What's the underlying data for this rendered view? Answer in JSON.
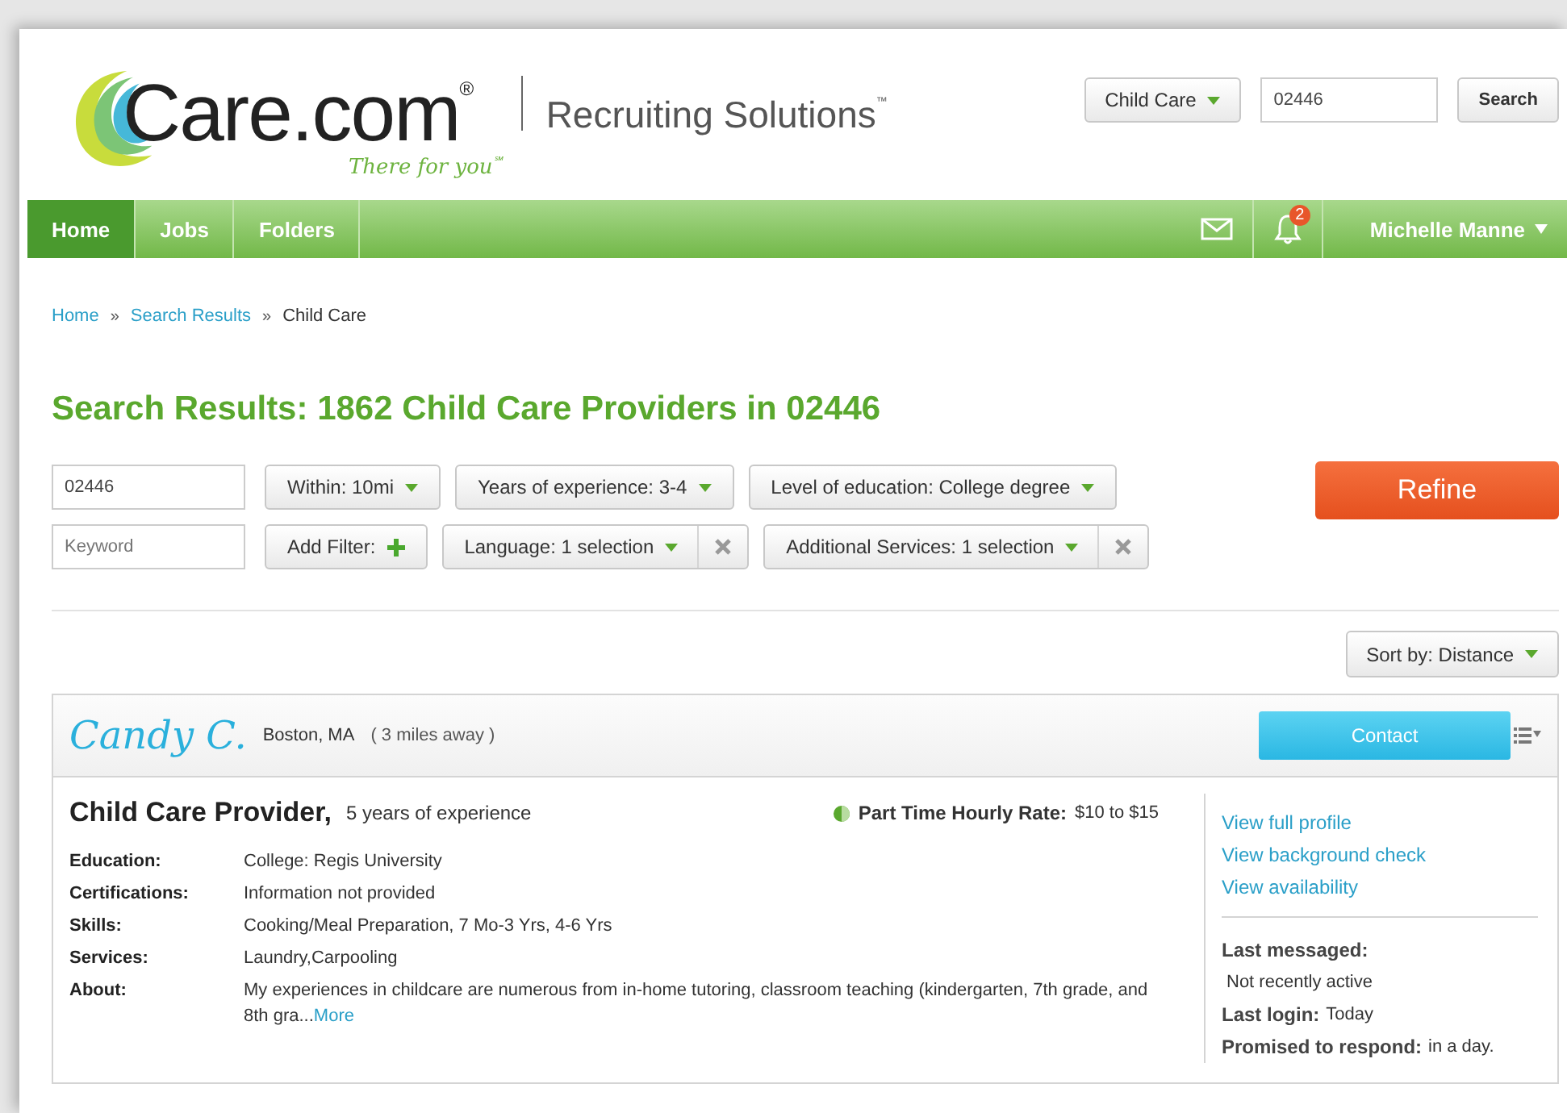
{
  "logo": {
    "name": "Care.com$^{®}$",
    "tagline": "There for you$^{℠}$"
  },
  "product": "Recruiting Solutions$^{™}$",
  "header_search": {
    "category": "Child Care",
    "zip": "02446",
    "button": "Search"
  },
  "nav": {
    "tabs": [
      {
        "label": "Home",
        "selected": true
      },
      {
        "label": "Jobs",
        "selected": false
      },
      {
        "label": "Folders",
        "selected": false
      }
    ],
    "notifications": "2",
    "user": "Michelle Manne"
  },
  "breadcrumbs": [
    {
      "label": "Home",
      "kind": "link"
    },
    {
      "label": "»",
      "kind": "separator"
    },
    {
      "label": "Search Results",
      "kind": "link"
    },
    {
      "label": "»",
      "kind": "separator"
    },
    {
      "label": "Child Care",
      "kind": "current"
    }
  ],
  "title": "Search Results: 1862 Child Care Providers in 02446",
  "filters": {
    "zip": "02446",
    "keyword_placeholder": "Keyword",
    "refine": "Refine",
    "rows": [
      [
        {
          "label": "Within: 10mi",
          "kind": "dropdown"
        },
        {
          "label": "Years of experience: 3-4",
          "kind": "dropdown"
        },
        {
          "label": "Level of education: College degree",
          "kind": "dropdown"
        }
      ],
      [
        {
          "label": "Add Filter:",
          "kind": "add"
        },
        {
          "label": "Language: 1 selection",
          "kind": "removable"
        },
        {
          "label": "Additional Services: 1 selection",
          "kind": "removable"
        }
      ]
    ]
  },
  "sort": "Sort by: Distance",
  "results": [
    {
      "name": "Candy C.",
      "location": "Boston, MA",
      "distance": "( 3 miles away )",
      "contact": "Contact",
      "role": "Child Care Provider,",
      "experience": "5 years of experience",
      "rate_label": "Part Time Hourly Rate:",
      "rate": "$10 to $15",
      "details": [
        {
          "label": "Education:",
          "value": "College: Regis University"
        },
        {
          "label": "Certifications:",
          "value": "Information not provided"
        },
        {
          "label": "Skills:",
          "value": "Cooking/Meal Preparation, 7 Mo-3 Yrs, 4-6 Yrs"
        },
        {
          "label": "Services:",
          "value": "Laundry,Carpooling"
        },
        {
          "label": "About:",
          "value": "My experiences in childcare are numerous from in-home tutoring, classroom teaching (kindergarten, 7th grade, and 8th gra...",
          "more": "More"
        }
      ],
      "links": [
        "View full profile",
        "View background check",
        "View availability"
      ],
      "activity": [
        {
          "label": "Last messaged:",
          "value": "Not recently active",
          "kind": "stacked"
        },
        {
          "label": "Last login:",
          "value": "Today",
          "kind": "inline"
        },
        {
          "label": "Promised to respond:",
          "value": "in a day.",
          "kind": "inline"
        }
      ]
    }
  ]
}
